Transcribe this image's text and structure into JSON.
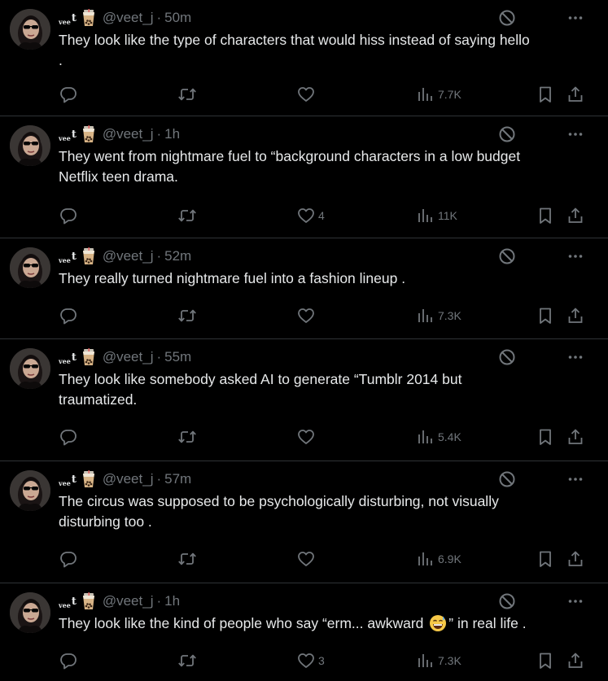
{
  "colors": {
    "background": "#000000",
    "text": "#e7e9ea",
    "muted": "#71767b",
    "divider": "#2f3336"
  },
  "icons": {
    "reply": "reply-icon",
    "retweet": "retweet-icon",
    "like": "heart-icon",
    "views": "views-icon",
    "bookmark": "bookmark-icon",
    "share": "share-icon",
    "block": "block-icon",
    "more": "more-icon",
    "badge": "bubble-tea-icon"
  },
  "tweets": [
    {
      "name_small": "vee",
      "name_main": "t",
      "handle": "@veet_j",
      "separator": "·",
      "time": "50m",
      "text": "They look like the type of characters that would hiss instead of saying hello\n.",
      "replies": "",
      "retweets": "",
      "likes": "",
      "views": "7.7K"
    },
    {
      "name_small": "vee",
      "name_main": "t",
      "handle": "@veet_j",
      "separator": "·",
      "time": "1h",
      "text": "They went from nightmare fuel to “background characters in a low budget\nNetflix teen drama.",
      "replies": "",
      "retweets": "",
      "likes": "4",
      "views": "11K"
    },
    {
      "name_small": "vee",
      "name_main": "t",
      "handle": "@veet_j",
      "separator": "·",
      "time": "52m",
      "text": "They really turned nightmare fuel into a fashion lineup .",
      "replies": "",
      "retweets": "",
      "likes": "",
      "views": "7.3K"
    },
    {
      "name_small": "vee",
      "name_main": "t",
      "handle": "@veet_j",
      "separator": "·",
      "time": "55m",
      "text": "They look like somebody asked AI to generate “Tumblr 2014 but\ntraumatized.",
      "replies": "",
      "retweets": "",
      "likes": "",
      "views": "5.4K"
    },
    {
      "name_small": "vee",
      "name_main": "t",
      "handle": "@veet_j",
      "separator": "·",
      "time": "57m",
      "text": "The circus was supposed to be psychologically disturbing, not visually\ndisturbing too .",
      "replies": "",
      "retweets": "",
      "likes": "",
      "views": "6.9K"
    },
    {
      "name_small": "vee",
      "name_main": "t",
      "handle": "@veet_j",
      "separator": "·",
      "time": "1h",
      "text_before": "They look like the kind of people who say “erm... awkward ",
      "text_after": "” in real life .",
      "text_emoji": "grinning-sweat-emoji",
      "replies": "",
      "retweets": "",
      "likes": "3",
      "views": "7.3K"
    }
  ]
}
